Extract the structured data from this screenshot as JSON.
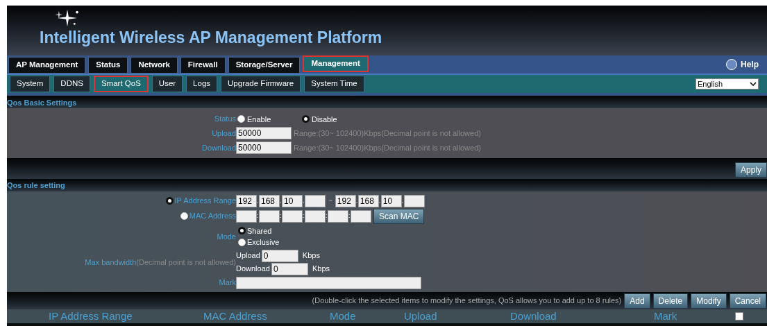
{
  "header": {
    "title": "Intelligent Wireless AP Management Platform"
  },
  "nav": {
    "tabs": [
      {
        "label": "AP Management",
        "selected": false
      },
      {
        "label": "Status",
        "selected": false
      },
      {
        "label": "Network",
        "selected": false
      },
      {
        "label": "Firewall",
        "selected": false
      },
      {
        "label": "Storage/Server",
        "selected": false
      },
      {
        "label": "Management",
        "selected": true
      }
    ],
    "help": "Help"
  },
  "subnav": {
    "tabs": [
      {
        "label": "System",
        "selected": false
      },
      {
        "label": "DDNS",
        "selected": false
      },
      {
        "label": "Smart QoS",
        "selected": true
      },
      {
        "label": "User",
        "selected": false
      },
      {
        "label": "Logs",
        "selected": false
      },
      {
        "label": "Upgrade Firmware",
        "selected": false
      },
      {
        "label": "System Time",
        "selected": false
      }
    ],
    "language": "English"
  },
  "basic": {
    "title": "Qos Basic Settings",
    "status": {
      "label": "Status",
      "options": [
        {
          "label": "Enable",
          "selected": false
        },
        {
          "label": "Disable",
          "selected": true
        }
      ]
    },
    "rates": [
      {
        "label": "Upload",
        "value": "50000",
        "hint": "Range:(30~ 102400)Kbps(Decimal point is not allowed)"
      },
      {
        "label": "Download",
        "value": "50000",
        "hint": "Range:(30~ 102400)Kbps(Decimal point is not allowed)"
      }
    ],
    "apply": "Apply"
  },
  "rule": {
    "title": "Qos rule setting",
    "ip_range": {
      "label": "IP Address Range",
      "selected": true,
      "start": [
        "192",
        "168",
        "10"
      ],
      "end": [
        "192",
        "168",
        "10"
      ],
      "separator": "~",
      "dot": "."
    },
    "mac": {
      "label": "MAC Address",
      "selected": false,
      "colon": ":",
      "scan": "Scan MAC"
    },
    "mode": {
      "label": "Mode",
      "options": [
        {
          "label": "Shared",
          "selected": true
        },
        {
          "label": "Exclusive",
          "selected": false
        }
      ]
    },
    "bandwidth": {
      "label": "Max bandwidth",
      "note": "(Decimal point is not allowed)",
      "rows": [
        {
          "label": "Upload",
          "value": "0",
          "unit": "Kbps"
        },
        {
          "label": "Download",
          "value": "0",
          "unit": "Kbps"
        }
      ]
    },
    "mark": {
      "label": "Mark"
    },
    "note": "(Double-click the selected items to modify the settings, QoS allows you to add up to 8 rules)",
    "buttons": [
      "Add",
      "Delete",
      "Modify",
      "Cancel"
    ]
  },
  "table": {
    "columns": [
      "IP Address Range",
      "MAC Address",
      "Mode",
      "Upload",
      "Download",
      "Mark"
    ],
    "select_all": {
      "checked": false
    }
  }
}
